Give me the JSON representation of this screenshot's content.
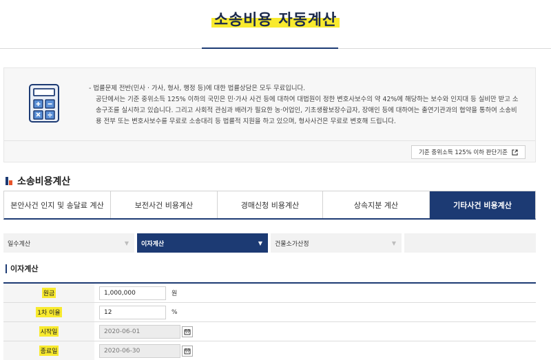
{
  "page": {
    "title": "소송비용 자동계산"
  },
  "info": {
    "line1": "- 법률문제 전반(민사 · 가사, 형사, 행정 등)에 대한 법률상담은 모두 무료입니다.",
    "line2": "공단에서는 기준 중위소득 125% 이하의 국민은 민·가사 사건 등에 대하여 대법원이 정한 변호사보수의 약 42%에 해당하는 보수와 인지대 등 실비만 받고 소송구조를 실시하고 있습니다. 그리고 사회적 관심과 배려가 필요한 농·어업인, 기초생활보장수급자, 장애인 등에 대하여는 출연기관과의 협약을 통하여 소송비용 전부 또는 변호사보수를 무료로 소송대리 등 법률적 지원을 하고 있으며, 형사사건은 무료로 변호해 드립니다.",
    "criteria_button": "기준 중위소득 125% 이하 판단기준"
  },
  "section": {
    "title": "소송비용계산"
  },
  "tabs": [
    {
      "label": "본안사건 인지 및 송달료 계산"
    },
    {
      "label": "보전사건 비용계산"
    },
    {
      "label": "경매신청 비용계산"
    },
    {
      "label": "상속지분 계산"
    },
    {
      "label": "기타사건 비용계산"
    }
  ],
  "subtabs": [
    {
      "label": "일수계산"
    },
    {
      "label": "이자계산"
    },
    {
      "label": "건물소가산정"
    }
  ],
  "form": {
    "title": "이자계산",
    "rows": [
      {
        "label": "원금",
        "value": "1,000,000",
        "unit": "원"
      },
      {
        "label": "1차 이율",
        "value": "12",
        "unit": "%"
      },
      {
        "label": "시작일",
        "value": "2020-06-01"
      },
      {
        "label": "종료일",
        "value": "2020-06-30"
      }
    ]
  },
  "colors": {
    "navy": "#1c3a73",
    "highlight": "#f8ea2e",
    "orange": "#e8542a"
  },
  "icons": {
    "calculator": "calculator-icon",
    "external_link": "external-link-icon",
    "calendar": "calendar-icon",
    "dropdown": "triangle-down-icon"
  }
}
